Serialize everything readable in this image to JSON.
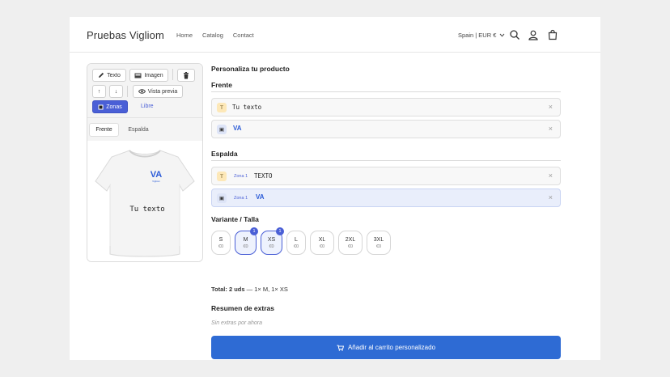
{
  "header": {
    "brand": "Pruebas Vigliom",
    "nav": [
      "Home",
      "Catalog",
      "Contact"
    ],
    "locale": "Spain | EUR €"
  },
  "toolbar": {
    "text_label": "Texto",
    "image_label": "Imagen",
    "up_label": "↑",
    "down_label": "↓",
    "preview_label": "Vista previa",
    "zones_label": "Zonas",
    "free_label": "Libre"
  },
  "sides": {
    "front": "Frente",
    "back": "Espalda"
  },
  "preview": {
    "text": "Tu texto",
    "logo_text": "VA",
    "logo_sub": "Vigliom"
  },
  "panel": {
    "title": "Personaliza tu producto",
    "front_heading": "Frente",
    "back_heading": "Espalda",
    "front_layers": [
      {
        "badge": "T",
        "text": "Tu texto"
      },
      {
        "badge": "▣",
        "logo": "VA"
      }
    ],
    "back_layers": [
      {
        "badge": "T",
        "zone": "Zona 1",
        "text": "TEXTO"
      },
      {
        "badge": "▣",
        "zone": "Zona 1",
        "logo": "VA"
      }
    ],
    "close_glyph": "×",
    "variant_heading": "Variante / Talla",
    "sizes": [
      {
        "name": "S",
        "price": "€0"
      },
      {
        "name": "M",
        "price": "€0",
        "qty": "1"
      },
      {
        "name": "XS",
        "price": "€0",
        "qty": "1"
      },
      {
        "name": "L",
        "price": "€0"
      },
      {
        "name": "XL",
        "price": "€0"
      },
      {
        "name": "2XL",
        "price": "€0"
      },
      {
        "name": "3XL",
        "price": "€0"
      }
    ],
    "total_label": "Total: 2 uds",
    "total_detail": " — 1× M, 1× XS",
    "extras_heading": "Resumen de extras",
    "extras_empty": "Sin extras por ahora",
    "cart_label": "Añadir al carrito personalizado"
  },
  "colors": {
    "accent": "#4a5fd6",
    "cart": "#2e6bd4",
    "logo": "#2b5bd7"
  }
}
